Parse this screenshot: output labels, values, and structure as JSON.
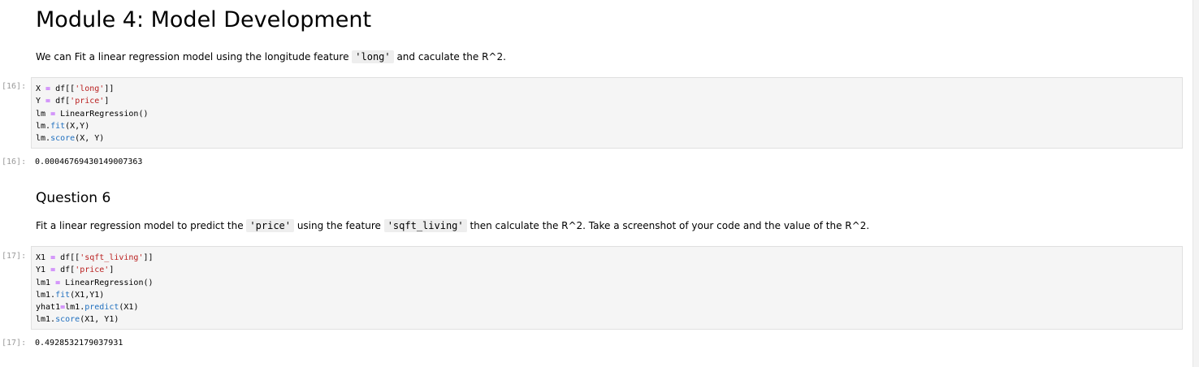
{
  "title": "Module 4: Model Development",
  "intro": {
    "before": "We can Fit a linear regression model using the longitude feature ",
    "code": "'long'",
    "after": " and caculate the R^2."
  },
  "cell1": {
    "prompt_in": "[16]:",
    "lines": [
      [
        {
          "t": "X "
        },
        {
          "t": "=",
          "k": "op"
        },
        {
          "t": " df[["
        },
        {
          "t": "'long'",
          "k": "str"
        },
        {
          "t": "]]"
        }
      ],
      [
        {
          "t": "Y "
        },
        {
          "t": "=",
          "k": "op"
        },
        {
          "t": " df["
        },
        {
          "t": "'price'",
          "k": "str"
        },
        {
          "t": "]"
        }
      ],
      [
        {
          "t": "lm "
        },
        {
          "t": "=",
          "k": "op"
        },
        {
          "t": " LinearRegression()"
        }
      ],
      [
        {
          "t": "lm."
        },
        {
          "t": "fit",
          "k": "fn"
        },
        {
          "t": "(X,Y)"
        }
      ],
      [
        {
          "t": "lm."
        },
        {
          "t": "score",
          "k": "fn"
        },
        {
          "t": "(X, Y)"
        }
      ]
    ],
    "prompt_out": "[16]:",
    "output": "0.00046769430149007363"
  },
  "question": "Question 6",
  "q_text": {
    "p1": "Fit a linear regression model to predict the ",
    "c1": "'price'",
    "p2": " using the feature ",
    "c2": "'sqft_living'",
    "p3": " then calculate the R^2. Take a screenshot of your code and the value of the R^2."
  },
  "cell2": {
    "prompt_in": "[17]:",
    "lines": [
      [
        {
          "t": "X1 "
        },
        {
          "t": "=",
          "k": "op"
        },
        {
          "t": " df[["
        },
        {
          "t": "'sqft_living'",
          "k": "str"
        },
        {
          "t": "]]"
        }
      ],
      [
        {
          "t": "Y1 "
        },
        {
          "t": "=",
          "k": "op"
        },
        {
          "t": " df["
        },
        {
          "t": "'price'",
          "k": "str"
        },
        {
          "t": "]"
        }
      ],
      [
        {
          "t": "lm1 "
        },
        {
          "t": "=",
          "k": "op"
        },
        {
          "t": " LinearRegression()"
        }
      ],
      [
        {
          "t": "lm1."
        },
        {
          "t": "fit",
          "k": "fn"
        },
        {
          "t": "(X1,Y1)"
        }
      ],
      [
        {
          "t": "yhat1"
        },
        {
          "t": "=",
          "k": "op"
        },
        {
          "t": "lm1."
        },
        {
          "t": "predict",
          "k": "fn"
        },
        {
          "t": "(X1)"
        }
      ],
      [
        {
          "t": "lm1."
        },
        {
          "t": "score",
          "k": "fn"
        },
        {
          "t": "(X1, Y1)"
        }
      ]
    ],
    "prompt_out": "[17]:",
    "output": "0.4928532179037931"
  },
  "colors": {
    "string": "#ba2121",
    "operator": "#aa22ff",
    "method": "#1f6fbf",
    "prompt": "#9a9a9a",
    "cell_background": "#f5f5f5"
  }
}
